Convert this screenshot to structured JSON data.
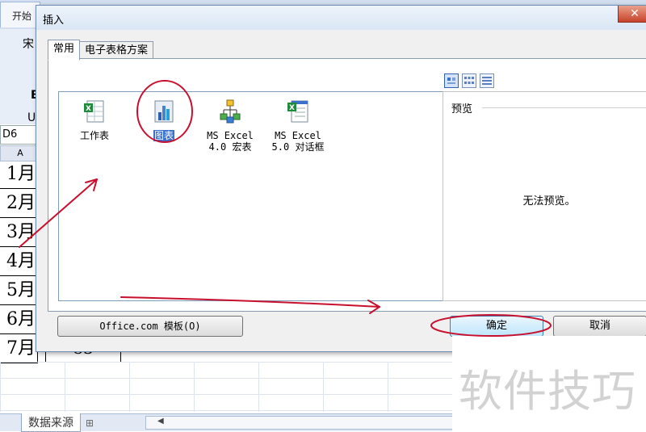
{
  "excel": {
    "active_tab": "开始",
    "ribbon_font_fragment": "宋",
    "name_box": "D6",
    "column_header": "A",
    "rows": [
      "1月",
      "2月",
      "3月",
      "4月",
      "5月",
      "6月",
      "7月"
    ],
    "visible_value": "83",
    "sheet_tab": "数据来源"
  },
  "dialog": {
    "title": "插入",
    "close_icon": "close-icon",
    "tabs": [
      "常用",
      "电子表格方案"
    ],
    "active_tab_index": 0,
    "items": [
      {
        "label_line1": "工作表",
        "label_line2": "",
        "icon": "worksheet-icon",
        "selected": false
      },
      {
        "label_line1": "图表",
        "label_line2": "",
        "icon": "chart-icon",
        "selected": true
      },
      {
        "label_line1": "MS Excel",
        "label_line2": "4.0 宏表",
        "icon": "macro-sheet-icon",
        "selected": false
      },
      {
        "label_line1": "MS Excel",
        "label_line2": "5.0 对话框",
        "icon": "dialog-sheet-icon",
        "selected": false
      }
    ],
    "view_buttons": [
      "large-icons-view-icon",
      "list-view-icon",
      "details-view-icon"
    ],
    "preview": {
      "label": "预览",
      "empty_text": "无法预览。"
    },
    "office_button": "Office.com 模板(O)",
    "ok_button": "确定",
    "cancel_button": "取消"
  },
  "annotation_color": "#c8102e",
  "watermark": "软件技巧"
}
